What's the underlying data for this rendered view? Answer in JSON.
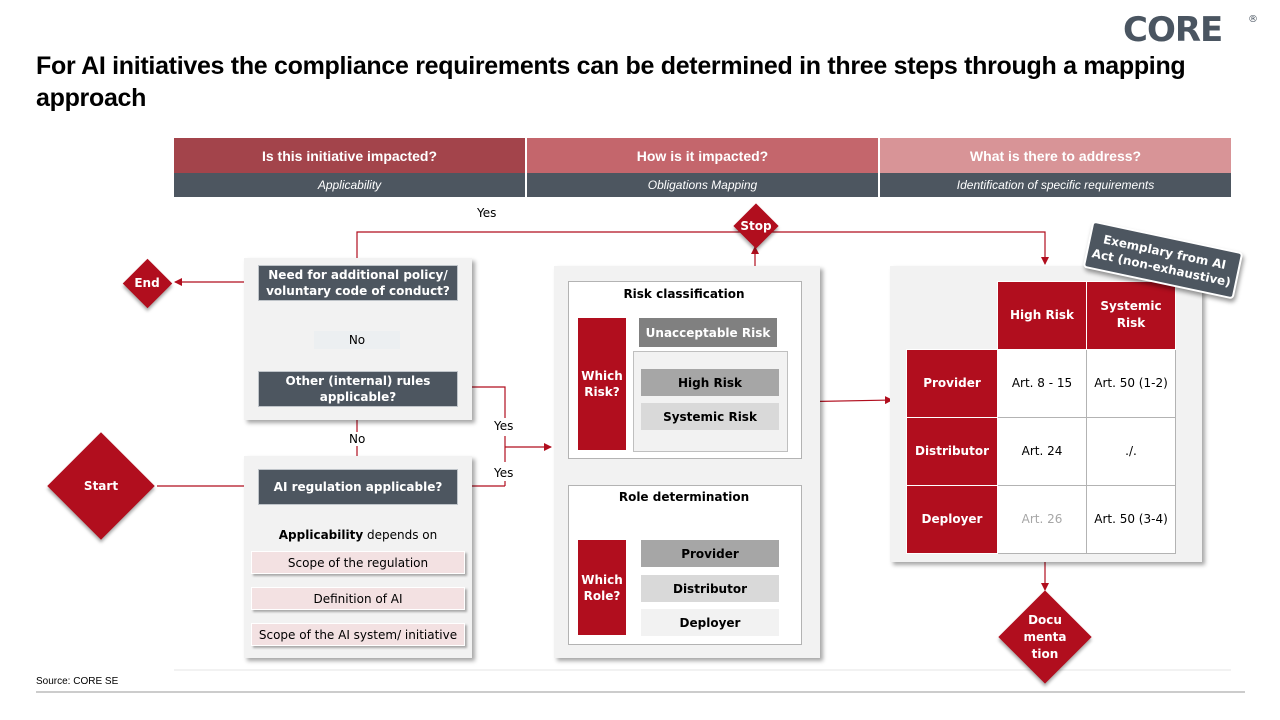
{
  "title": "For AI initiatives the compliance requirements can be determined in three steps through a mapping approach",
  "logo": {
    "text": "CORE",
    "reg_mark": "®"
  },
  "colors": {
    "brand_red": "#b10e1e",
    "dark_grey": "#4d5660",
    "header_1": "#a3444b",
    "header_2": "#c4666c",
    "header_3": "#d89497"
  },
  "steps": [
    {
      "question": "Is this initiative impacted?",
      "label": "Applicability"
    },
    {
      "question": "How is it impacted?",
      "label": "Obligations Mapping"
    },
    {
      "question": "What is there to address?",
      "label": "Identification of specific requirements"
    }
  ],
  "flow": {
    "start": "Start",
    "end": "End",
    "stop": "Stop",
    "documentation": "Docu\nmenta\ntion",
    "q_ai_regulation": "AI regulation applicable?",
    "q_other_rules": "Other (internal) rules applicable?",
    "q_additional_policy": "Need for additional policy/ voluntary code of conduct?",
    "yes": "Yes",
    "no": "No",
    "applicability_bold": "Applicability",
    "applicability_rest": " depends on",
    "applicability_factors": [
      "Scope of the regulation",
      "Definition of AI",
      "Scope of the AI system/ initiative"
    ]
  },
  "risk_classification": {
    "title": "Risk classification",
    "question": "Which Risk?",
    "levels": [
      "Unacceptable Risk",
      "High Risk",
      "Systemic Risk"
    ]
  },
  "role_determination": {
    "title": "Role determination",
    "question": "Which Role?",
    "roles": [
      "Provider",
      "Distributor",
      "Deployer"
    ]
  },
  "matrix": {
    "note": "Exemplary from AI Act (non-exhaustive)",
    "columns": [
      "High Risk",
      "Systemic Risk"
    ],
    "rows": [
      {
        "role": "Provider",
        "cells": [
          "Art. 8 - 15",
          "Art. 50  (1-2)"
        ]
      },
      {
        "role": "Distributor",
        "cells": [
          "Art. 24",
          "./."
        ]
      },
      {
        "role": "Deployer",
        "cells": [
          "Art. 26",
          "Art. 50  (3-4)"
        ]
      }
    ]
  },
  "source": "Source: CORE  SE"
}
